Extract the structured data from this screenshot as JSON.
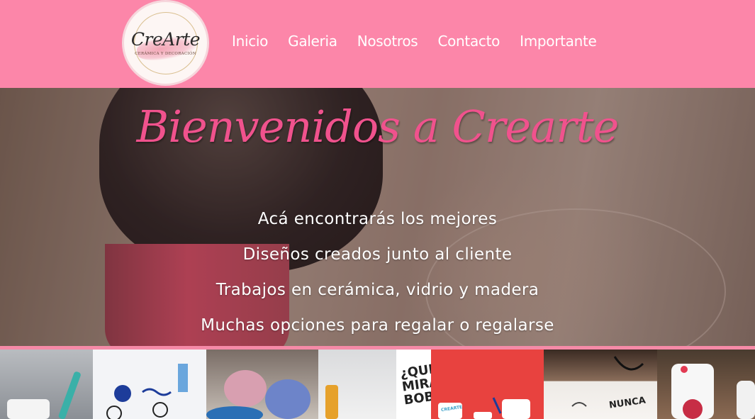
{
  "logo": {
    "brand": "CreArte",
    "tagline": "Cerámica y Decoración"
  },
  "nav": {
    "items": [
      "Inicio",
      "Galeria",
      "Nosotros",
      "Contacto",
      "Importante"
    ]
  },
  "hero": {
    "title": "Bienvenidos a Crearte",
    "lines": [
      "Acá encontrarás los mejores",
      "Diseños creados junto al cliente",
      "Trabajos en cerámica, vidrio y madera",
      "Muchas opciones para regalar o regalarse"
    ]
  },
  "gallery": {
    "thumb_texts": {
      "mug_text": "¿QUE MIRA BOBO",
      "brand_mark": "CREARTE",
      "nunca": "NUNCA"
    }
  },
  "colors": {
    "header_bg": "#fc86a9",
    "title_pink": "#f0528d",
    "nav_text": "#ffffff"
  }
}
